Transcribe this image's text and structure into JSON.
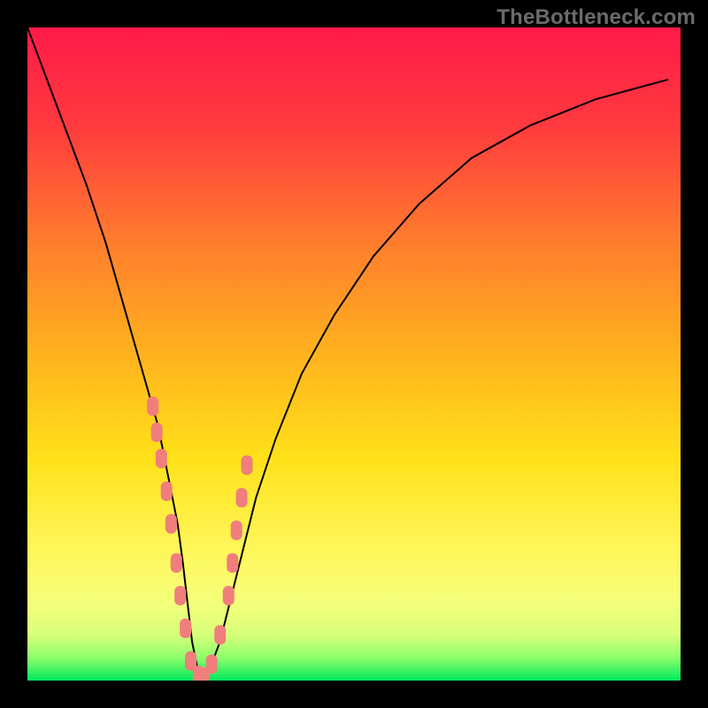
{
  "watermark_text": "TheBottleneck.com",
  "colors": {
    "frame": "#000000",
    "curve_stroke": "#000000",
    "marker_fill": "#ef7e7c",
    "gradient_stops": [
      {
        "offset": 0.0,
        "color": "#ff1a49"
      },
      {
        "offset": 0.15,
        "color": "#ff3a3e"
      },
      {
        "offset": 0.32,
        "color": "#ff7a2e"
      },
      {
        "offset": 0.5,
        "color": "#ffb21e"
      },
      {
        "offset": 0.66,
        "color": "#ffe119"
      },
      {
        "offset": 0.8,
        "color": "#fff65a"
      },
      {
        "offset": 0.88,
        "color": "#f4ff7a"
      },
      {
        "offset": 0.93,
        "color": "#d8ff7a"
      },
      {
        "offset": 0.965,
        "color": "#8cff6a"
      },
      {
        "offset": 1.0,
        "color": "#00e85e"
      }
    ]
  },
  "chart_data": {
    "type": "line",
    "title": "",
    "xlabel": "",
    "ylabel": "",
    "xlim": [
      0,
      100
    ],
    "ylim": [
      0,
      100
    ],
    "grid": false,
    "legend": false,
    "series": [
      {
        "name": "bottleneck-curve",
        "x": [
          0,
          3,
          6,
          9,
          12,
          14,
          16,
          18,
          20,
          21,
          22,
          23,
          23.8,
          24.5,
          25.2,
          26,
          27,
          28,
          29.5,
          31,
          33,
          35,
          38,
          42,
          47,
          53,
          60,
          68,
          77,
          87,
          98
        ],
        "y": [
          100,
          92,
          84,
          76,
          67,
          60,
          53,
          46,
          39,
          34,
          29,
          24,
          18,
          12,
          6,
          2,
          0.5,
          2,
          6,
          12,
          20,
          28,
          37,
          47,
          56,
          65,
          73,
          80,
          85,
          89,
          92
        ]
      }
    ],
    "markers": {
      "series": "bottleneck-curve",
      "shape": "rounded-rect",
      "points_x": [
        19.2,
        19.8,
        20.5,
        21.3,
        22.0,
        22.8,
        23.4,
        24.2,
        25.0,
        26.2,
        27.0,
        28.2,
        29.5,
        30.8,
        31.4,
        32.0,
        32.8,
        33.6
      ],
      "points_y": [
        42.0,
        38.0,
        34.0,
        29.0,
        24.0,
        18.0,
        13.0,
        8.0,
        3.0,
        0.8,
        0.5,
        2.5,
        7.0,
        13.0,
        18.0,
        23.0,
        28.0,
        33.0
      ]
    }
  }
}
